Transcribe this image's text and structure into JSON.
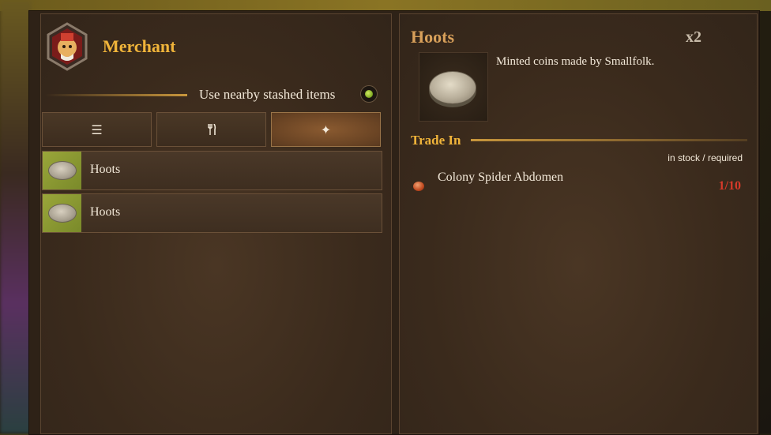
{
  "merchant": {
    "title": "Merchant",
    "stash_label": "Use nearby stashed items",
    "stash_enabled": true
  },
  "tabs": [
    {
      "icon": "list-icon",
      "glyph": "☰",
      "active": false
    },
    {
      "icon": "fork-knife-icon",
      "glyph": "🍴",
      "active": false
    },
    {
      "icon": "sparkle-icon",
      "glyph": "✦",
      "active": true
    }
  ],
  "list": [
    {
      "label": "Hoots"
    },
    {
      "label": "Hoots"
    }
  ],
  "detail": {
    "title": "Hoots",
    "quantity": "x2",
    "description": "Minted coins made by Smallfolk.",
    "trade_in_label": "Trade In",
    "stock_header": "in stock / required",
    "requirements": [
      {
        "name": "Colony Spider Abdomen",
        "count": "1/10"
      }
    ]
  },
  "colors": {
    "accent_gold": "#f0b43a",
    "item_title": "#d8a05a",
    "insufficient_red": "#d83a2a"
  }
}
